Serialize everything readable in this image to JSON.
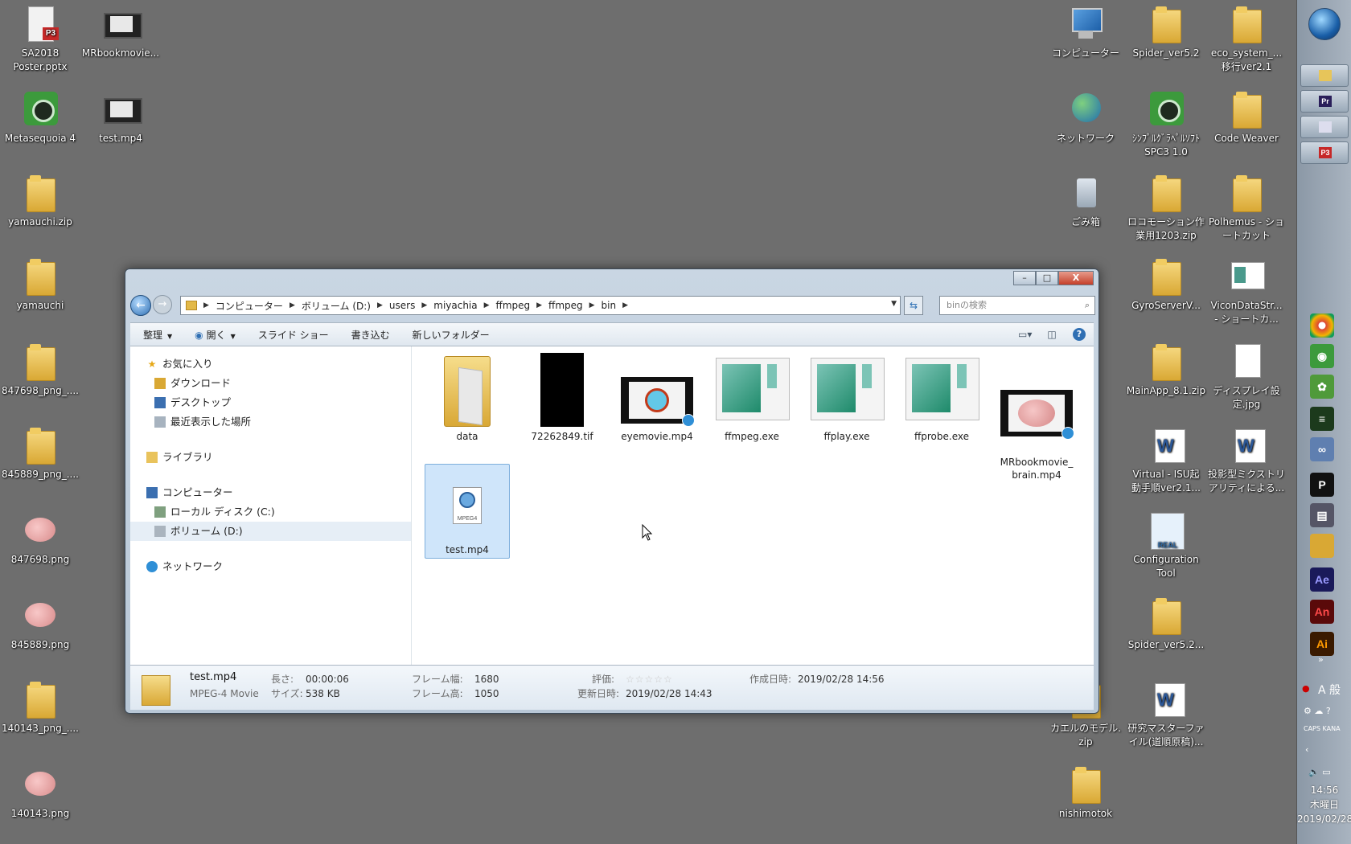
{
  "desktop": {
    "left_icons": [
      {
        "label": "SA2018\nPoster.pptx",
        "icon": "ppt-icon"
      },
      {
        "label": "MRbookmovie...",
        "icon": "video-icon"
      },
      {
        "label": "Metasequoia 4",
        "icon": "app-icon"
      },
      {
        "label": "test.mp4",
        "icon": "video-icon"
      },
      {
        "label": "yamauchi.zip",
        "icon": "folder-icon"
      },
      {
        "label": "yamauchi",
        "icon": "folder-icon"
      },
      {
        "label": "847698_png_....",
        "icon": "folder-icon"
      },
      {
        "label": "845889_png_....",
        "icon": "folder-icon"
      },
      {
        "label": "847698.png",
        "icon": "image-icon"
      },
      {
        "label": "845889.png",
        "icon": "image-icon"
      },
      {
        "label": "140143_png_....",
        "icon": "folder-icon"
      },
      {
        "label": "140143.png",
        "icon": "image-icon"
      }
    ],
    "right_icons": [
      {
        "label": "コンピューター",
        "icon": "computer-icon"
      },
      {
        "label": "Spider_ver5.2",
        "icon": "folder-icon"
      },
      {
        "label": "eco_system_...\n移行ver2.1",
        "icon": "folder-icon"
      },
      {
        "label": "ネットワーク",
        "icon": "network-icon"
      },
      {
        "label": "ｼﾝﾌﾟﾙｸﾞﾗﾍﾟﾙｿﾌﾄ\nSPC3 1.0",
        "icon": "app-icon"
      },
      {
        "label": "Code Weaver",
        "icon": "folder-icon"
      },
      {
        "label": "ごみ箱",
        "icon": "recycle-bin-icon"
      },
      {
        "label": "ロコモーション作\n業用1203.zip",
        "icon": "folder-icon"
      },
      {
        "label": "Polhemus - ショ\nートカット",
        "icon": "folder-icon"
      },
      {
        "label": "GyroServerV...",
        "icon": "folder-icon"
      },
      {
        "label": "ViconDataStr...\n- ショートカ...",
        "icon": "image-icon"
      },
      {
        "label": "MainApp_8.1.zip",
        "icon": "folder-icon"
      },
      {
        "label": "ディスプレイ設\n定.jpg",
        "icon": "image-icon"
      },
      {
        "label": "Virtual - ISU起\n動手順ver2.1...",
        "icon": "word-icon"
      },
      {
        "label": "投影型ミクストリ\nアリティによる...",
        "icon": "word-icon"
      },
      {
        "label": "Configuration\nTool",
        "icon": "config-icon"
      },
      {
        "label": "Spider_ver5.2...",
        "icon": "folder-icon"
      },
      {
        "label": "カエルのモデル.\nzip",
        "icon": "folder-icon"
      },
      {
        "label": "研究マスターファ\nイル(道順原稿)...",
        "icon": "word-icon"
      },
      {
        "label": "nishimotok",
        "icon": "folder-icon"
      }
    ]
  },
  "taskbar": {
    "tray_text": "A 般",
    "clock": {
      "time": "14:56",
      "weekday": "木曜日",
      "date": "2019/02/28"
    }
  },
  "explorer": {
    "controls": {
      "minimize": "–",
      "maximize": "□",
      "close": "X"
    },
    "breadcrumb": [
      "コンピューター",
      "ボリューム (D:)",
      "users",
      "miyachia",
      "ffmpeg",
      "ffmpeg",
      "bin"
    ],
    "search_placeholder": "binの検索",
    "commands": [
      {
        "label": "整理",
        "dropdown": true
      },
      {
        "label": "開く",
        "dropdown": true
      },
      {
        "label": "スライド ショー",
        "dropdown": false
      },
      {
        "label": "書き込む",
        "dropdown": false
      },
      {
        "label": "新しいフォルダー",
        "dropdown": false
      }
    ],
    "nav": {
      "favorites": "お気に入り",
      "downloads": "ダウンロード",
      "desktop": "デスクトップ",
      "recent": "最近表示した場所",
      "libraries": "ライブラリ",
      "computer": "コンピューター",
      "local_disk": "ローカル ディスク (C:)",
      "volume_d": "ボリューム (D:)",
      "network": "ネットワーク"
    },
    "files": [
      {
        "name": "data",
        "type": "folder"
      },
      {
        "name": "72262849.tif",
        "type": "image"
      },
      {
        "name": "eyemovie.mp4",
        "type": "movie"
      },
      {
        "name": "ffmpeg.exe",
        "type": "exe"
      },
      {
        "name": "ffplay.exe",
        "type": "exe"
      },
      {
        "name": "ffprobe.exe",
        "type": "exe"
      },
      {
        "name": "MRbookmovie_\nbrain.mp4",
        "type": "movie"
      },
      {
        "name": "test.mp4",
        "type": "mp4",
        "selected": true
      }
    ],
    "details": {
      "name": "test.mp4",
      "type": "MPEG-4 Movie",
      "length_label": "長さ:",
      "length": "00:00:06",
      "size_label": "サイズ:",
      "size": "538 KB",
      "frame_width_label": "フレーム幅:",
      "frame_width": "1680",
      "frame_height_label": "フレーム高:",
      "frame_height": "1050",
      "rating_label": "評価:",
      "rating_stars": "☆☆☆☆☆",
      "modified_label": "更新日時:",
      "modified": "2019/02/28 14:43",
      "created_label": "作成日時:",
      "created": "2019/02/28 14:56"
    }
  }
}
